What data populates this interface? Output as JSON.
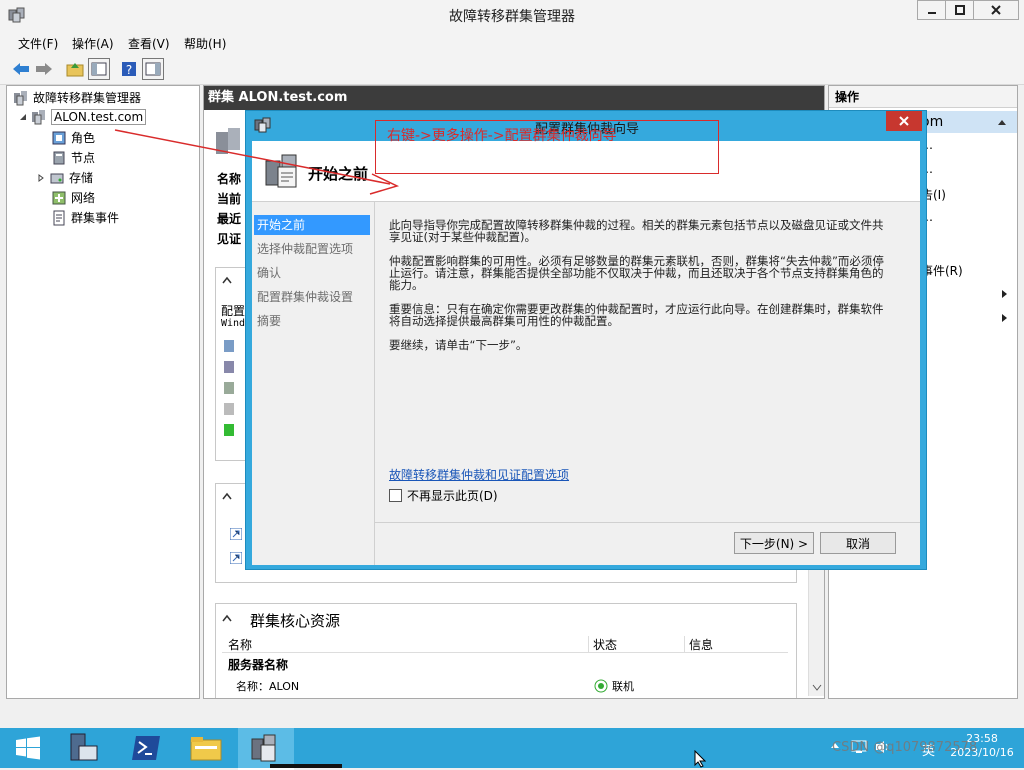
{
  "window": {
    "title": "故障转移群集管理器"
  },
  "menu": [
    "文件(F)",
    "操作(A)",
    "查看(V)",
    "帮助(H)"
  ],
  "tree": {
    "root": "故障转移群集管理器",
    "cluster": "ALON.test.com",
    "children": [
      "角色",
      "节点",
      "存储",
      "网络",
      "群集事件"
    ]
  },
  "center": {
    "header": "群集 ALON.test.com",
    "summary_labels": [
      "名称",
      "当前",
      "最近",
      "见证"
    ],
    "config_label": "配置",
    "config_sub": "Wind",
    "core_resources_title": "群集核心资源",
    "columns": [
      "名称",
      "状态",
      "信息"
    ],
    "group_label": "服务器名称",
    "row_name": "名称：ALON",
    "row_status": "联机"
  },
  "actions": {
    "header": "操作",
    "cluster_item": "om",
    "items": [
      "…",
      "…",
      "告(I)",
      "…",
      "事件(R)"
    ]
  },
  "dialog": {
    "title": "配置群集仲裁向导",
    "header": "开始之前",
    "steps": [
      "开始之前",
      "选择仲裁配置选项",
      "确认",
      "配置群集仲裁设置",
      "摘要"
    ],
    "active_step": 0,
    "paragraphs": [
      "此向导指导你完成配置故障转移群集仲裁的过程。相关的群集元素包括节点以及磁盘见证或文件共享见证(对于某些仲裁配置)。",
      "仲裁配置影响群集的可用性。必须有足够数量的群集元素联机，否则，群集将“失去仲裁”而必须停止运行。请注意，群集能否提供全部功能不仅取决于仲裁，而且还取决于各个节点支持群集角色的能力。",
      "重要信息：只有在确定你需要更改群集的仲裁配置时，才应运行此向导。在创建群集时，群集软件将自动选择提供最高群集可用性的仲裁配置。",
      "要继续，请单击“下一步”。"
    ],
    "link": "故障转移群集仲裁和见证配置选项",
    "checkbox_label": "不再显示此页(D)",
    "next_button": "下一步(N) >",
    "cancel_button": "取消"
  },
  "annotation": {
    "text": "右键->更多操作->配置群集仲裁向导",
    "color": "#d92b2b"
  },
  "taskbar": {
    "time": "23:58",
    "date": "2023/10/16",
    "ime": "英",
    "watermark": "CSDN @q1079872578"
  }
}
